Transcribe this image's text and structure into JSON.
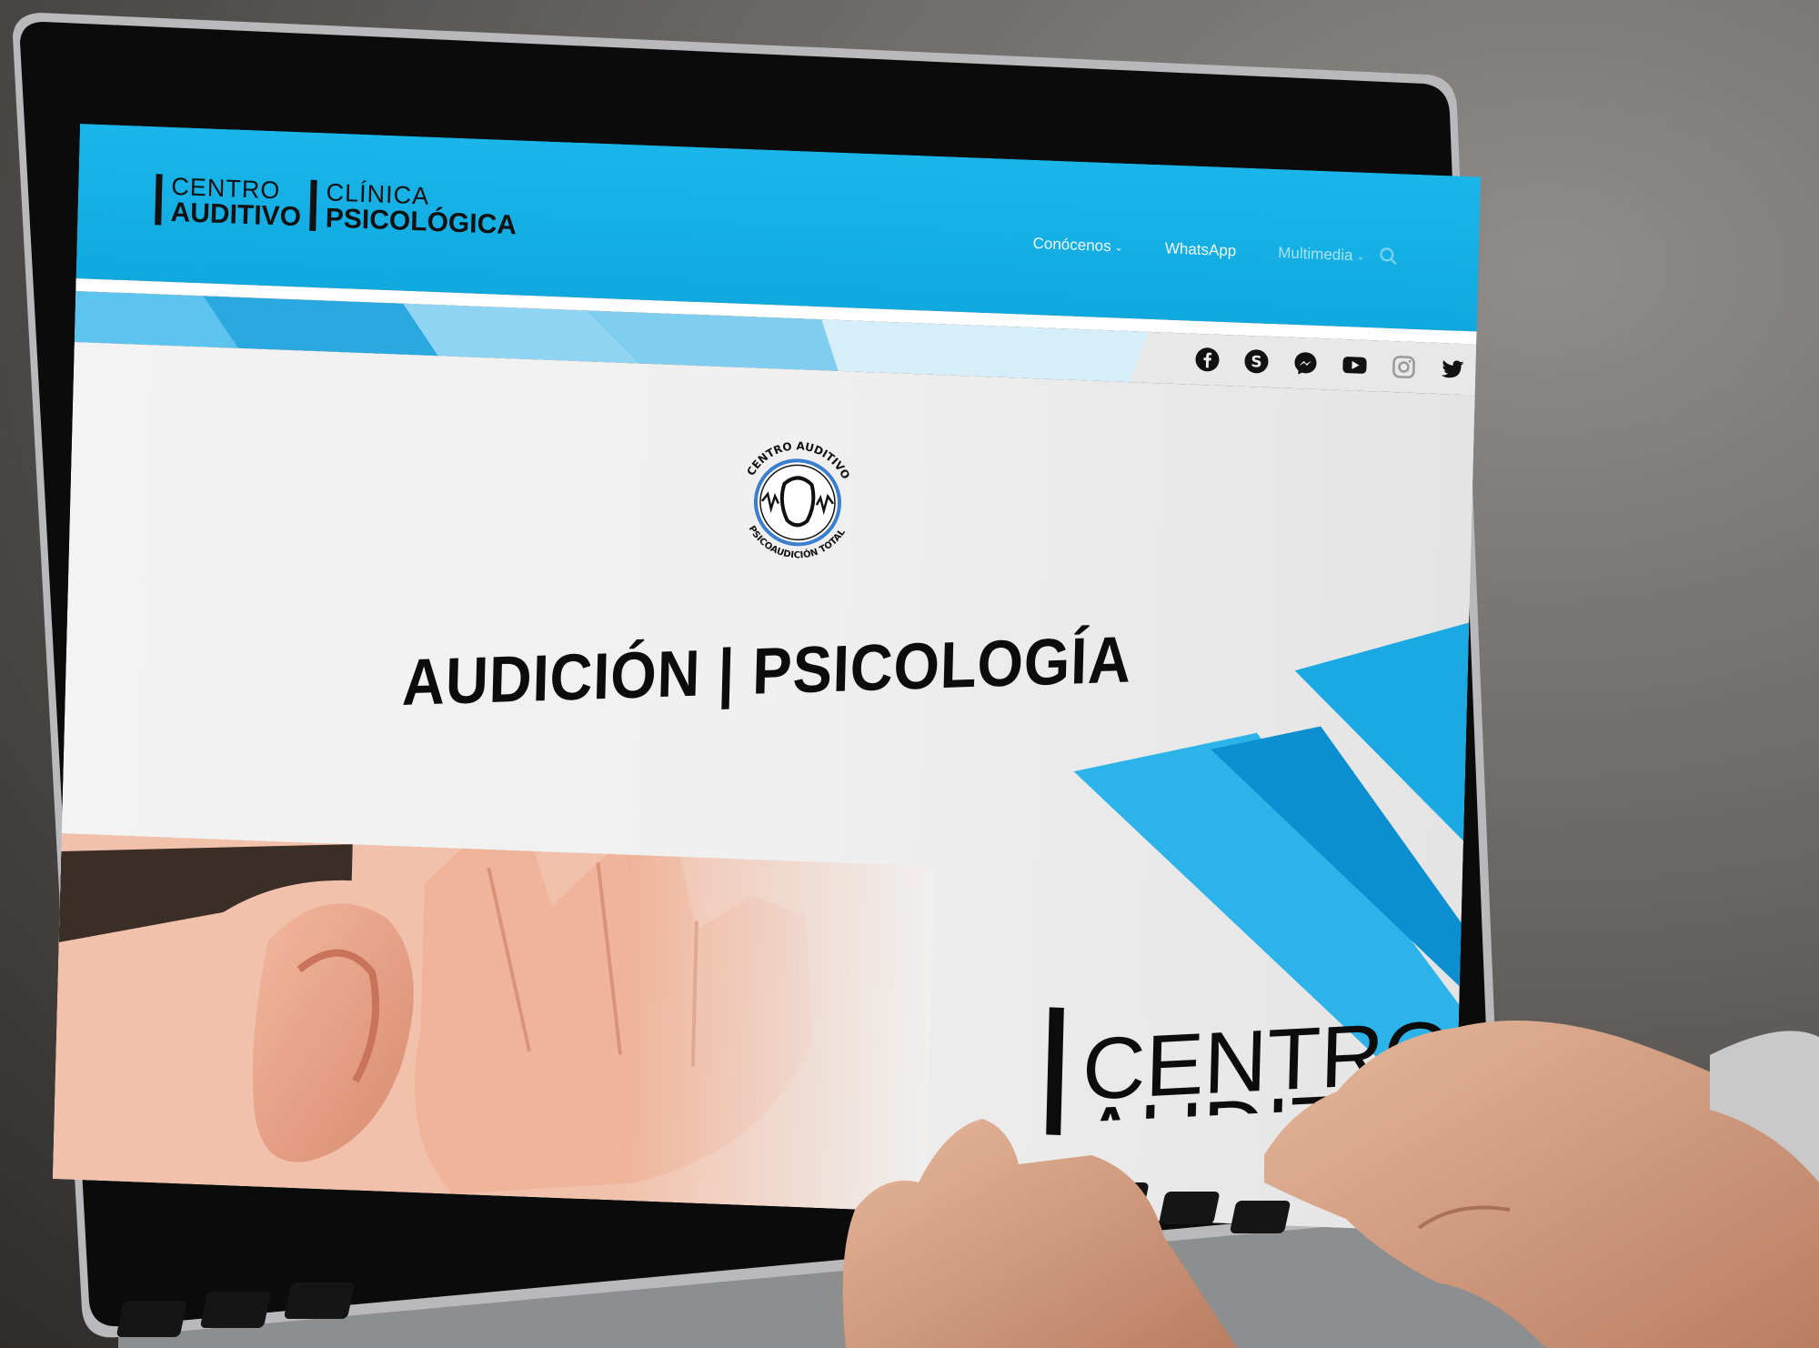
{
  "site": {
    "brand": {
      "left_top": "CENTRO",
      "left_bottom": "AUDITIVO",
      "right_top": "CLÍNICA",
      "right_bottom": "PSICOLÓGICA"
    },
    "nav": [
      {
        "label": "Conócenos",
        "has_dropdown": true
      },
      {
        "label": "WhatsApp",
        "has_dropdown": false
      },
      {
        "label": "Multimedia",
        "has_dropdown": true
      }
    ],
    "search_icon": "search-icon",
    "social_icons": [
      "facebook-icon",
      "skype-icon",
      "messenger-icon",
      "youtube-icon",
      "instagram-icon",
      "twitter-icon"
    ],
    "emblem": {
      "top_text": "CENTRO AUDITIVO",
      "bottom_text": "PSICOAUDICIÓN TOTAL"
    },
    "hero_title": "AUDICIÓN | PSICOLOGÍA",
    "hero_brand": {
      "line1": "CENTRO",
      "line2": "AUDITIVO"
    }
  },
  "colors": {
    "header_blue": "#12aee4",
    "accent_blue": "#1aa9e3",
    "dark_text": "#0c0c0c",
    "hero_bg": "#f1f1f1"
  }
}
